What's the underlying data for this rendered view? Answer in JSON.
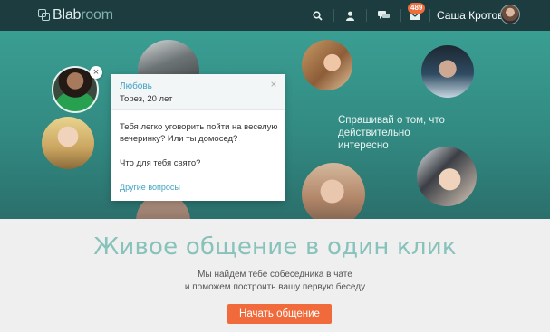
{
  "header": {
    "logo_bold": "Blab",
    "logo_light": "room",
    "icons": [
      "search-icon",
      "user-icon",
      "chat-icon",
      "mail-icon"
    ],
    "mail_badge": "489",
    "user_name": "Саша Кротов"
  },
  "hero": {
    "tagline": "Спрашивай о том, что действительно интересно",
    "card": {
      "name": "Любовь",
      "age_line": "Торез, 20 лет",
      "question1": "Тебя легко уговорить пойти на веселую вечеринку? Или ты домосед?",
      "question2": "Что для тебя свято?",
      "more_link": "Другие вопросы",
      "close_glyph": "×"
    },
    "avatar_close_glyph": "×"
  },
  "main": {
    "headline": "Живое общение в один клик",
    "subline1": "Мы найдем тебе собеседника в чате",
    "subline2": "и поможем построить вашу первую беседу",
    "cta_label": "Начать общение"
  },
  "colors": {
    "header_bg": "#1d3c40",
    "hero_teal": "#3a9e93",
    "accent_orange": "#f06a3b",
    "link_blue": "#3fa1c0",
    "headline_teal": "#87c2bb"
  }
}
